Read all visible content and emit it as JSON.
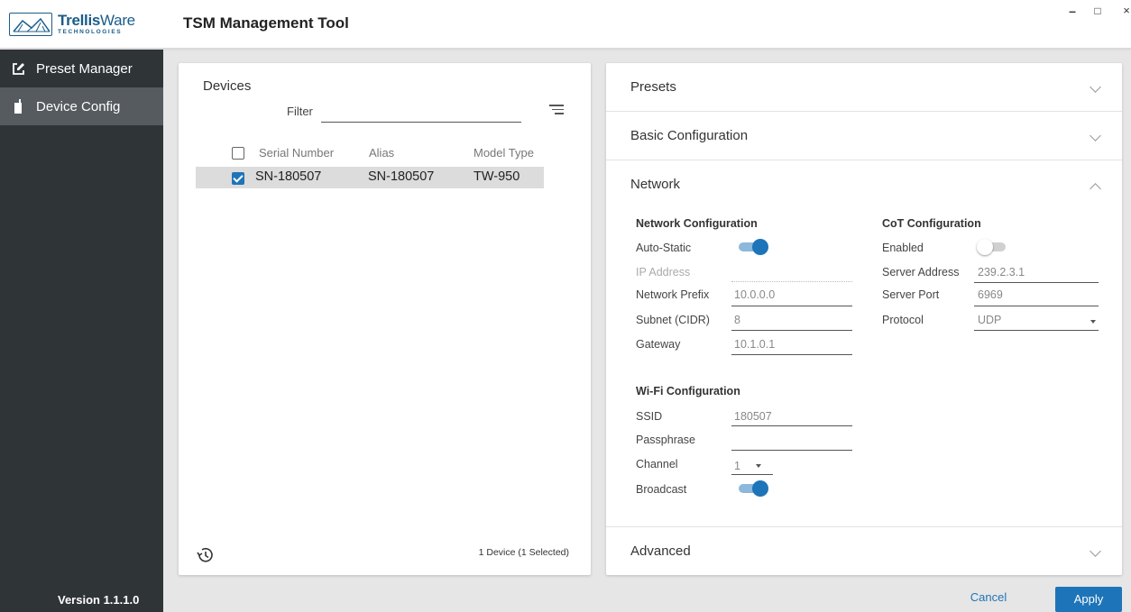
{
  "app": {
    "logo_name_bold": "Trellis",
    "logo_name_rest": "Ware",
    "logo_sub": "TECHNOLOGIES",
    "title": "TSM Management Tool",
    "window_controls": [
      "–",
      "□",
      "×"
    ]
  },
  "sidebar": {
    "items": [
      {
        "label": "Preset Manager",
        "icon": "edit-icon",
        "active": false
      },
      {
        "label": "Device Config",
        "icon": "device-icon",
        "active": true
      }
    ],
    "version": "Version 1.1.1.0"
  },
  "devices": {
    "title": "Devices",
    "filter_label": "Filter",
    "filter_value": "",
    "columns": [
      "Serial Number",
      "Alias",
      "Model Type"
    ],
    "rows": [
      {
        "serial": "SN-180507",
        "alias": "SN-180507",
        "model": "TW-950",
        "checked": true
      }
    ],
    "count_text": "1 Device (1 Selected)"
  },
  "accordion": {
    "presets": "Presets",
    "basic": "Basic Configuration",
    "network": "Network",
    "advanced": "Advanced"
  },
  "network": {
    "title": "Network Configuration",
    "auto_static_label": "Auto-Static",
    "auto_static_on": true,
    "ip_label": "IP Address",
    "ip_value": "",
    "prefix_label": "Network Prefix",
    "prefix_value": "10.0.0.0",
    "subnet_label": "Subnet (CIDR)",
    "subnet_value": "8",
    "gateway_label": "Gateway",
    "gateway_value": "10.1.0.1"
  },
  "cot": {
    "title": "CoT Configuration",
    "enabled_label": "Enabled",
    "enabled_on": false,
    "server_address_label": "Server Address",
    "server_address_value": "239.2.3.1",
    "server_port_label": "Server Port",
    "server_port_value": "6969",
    "protocol_label": "Protocol",
    "protocol_value": "UDP"
  },
  "wifi": {
    "title": "Wi-Fi Configuration",
    "ssid_label": "SSID",
    "ssid_value": "180507",
    "passphrase_label": "Passphrase",
    "passphrase_value": "",
    "channel_label": "Channel",
    "channel_value": "1",
    "broadcast_label": "Broadcast",
    "broadcast_on": true
  },
  "footer": {
    "cancel": "Cancel",
    "apply": "Apply"
  },
  "colors": {
    "accent": "#1e74b8",
    "sidebar_bg": "#2f3436",
    "sidebar_active": "#555b5e"
  }
}
